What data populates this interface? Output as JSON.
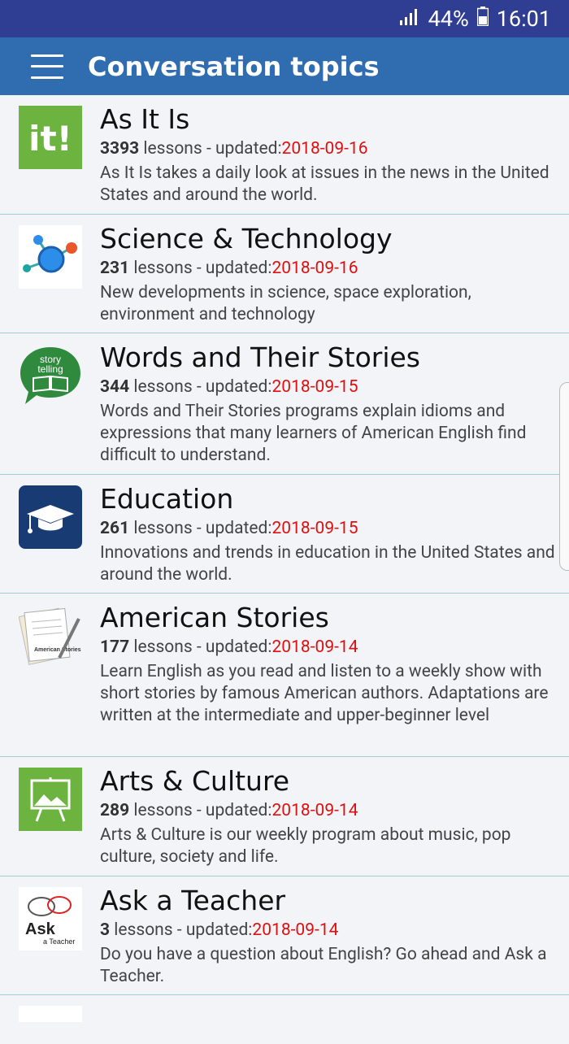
{
  "status": {
    "battery": "44%",
    "time": "16:01"
  },
  "appbar": {
    "title": "Conversation topics"
  },
  "items": [
    {
      "title": "As It Is",
      "count": "3393",
      "lessons_label": " lessons - updated:",
      "date": "2018-09-16",
      "desc": "As It Is takes a daily look at issues in the news in the United States and around the world."
    },
    {
      "title": "Science & Technology",
      "count": "231",
      "lessons_label": " lessons - updated:",
      "date": "2018-09-16",
      "desc": "New developments in science, space exploration, environment and technology"
    },
    {
      "title": "Words and Their Stories",
      "count": "344",
      "lessons_label": " lessons - updated:",
      "date": "2018-09-15",
      "desc": "Words and Their Stories programs explain idioms and expressions that many learners of American English find difficult to understand."
    },
    {
      "title": "Education",
      "count": "261",
      "lessons_label": " lessons - updated:",
      "date": "2018-09-15",
      "desc": "Innovations and trends in education in the United States and around the world."
    },
    {
      "title": "American Stories",
      "count": "177",
      "lessons_label": " lessons - updated:",
      "date": "2018-09-14",
      "desc": "Learn English as you read and listen to a weekly show with short stories by famous American authors. Adaptations are written at the intermediate and upper-beginner level"
    },
    {
      "title": "Arts & Culture",
      "count": "289",
      "lessons_label": " lessons - updated:",
      "date": "2018-09-14",
      "desc": "Arts & Culture is our weekly program about music, pop culture, society and life."
    },
    {
      "title": "Ask a Teacher",
      "count": "3",
      "lessons_label": " lessons - updated:",
      "date": "2018-09-14",
      "desc": "Do you have a question about English? Go ahead and Ask a Teacher."
    }
  ],
  "thumbs": {
    "it": "it!",
    "story_1": "story",
    "story_2": "telling",
    "ask_1": "Ask",
    "ask_2": "a Teacher",
    "paper": "American Stories"
  }
}
